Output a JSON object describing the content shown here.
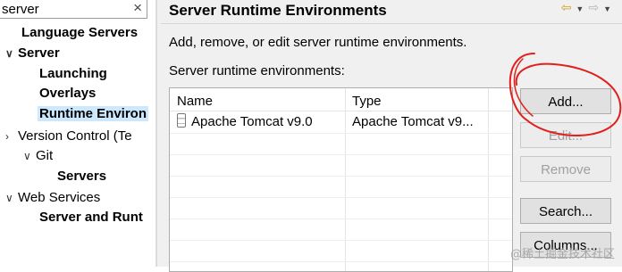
{
  "filter": {
    "value": "server",
    "clear_icon": "×"
  },
  "tree": [
    {
      "label": "Language Servers",
      "bold": true
    },
    {
      "label": "Server",
      "bold": true,
      "expanded": true
    },
    {
      "label": "Launching",
      "bold": true
    },
    {
      "label": "Overlays",
      "bold": true
    },
    {
      "label": "Runtime Environ",
      "bold": true,
      "selected": true
    },
    {
      "label": "Version Control (Te",
      "bold": false,
      "collapsed": true
    },
    {
      "label": "Git",
      "bold": false,
      "expanded": true
    },
    {
      "label": "Servers",
      "bold": true
    },
    {
      "label": "Web Services",
      "bold": false,
      "expanded": true
    },
    {
      "label": "Server and Runt",
      "bold": true
    }
  ],
  "page": {
    "title": "Server Runtime Environments",
    "description": "Add, remove, or edit server runtime environments.",
    "list_label": "Server runtime environments:",
    "nav_icons": [
      "back-arrow-icon",
      "forward-arrow-icon",
      "menu-chevron-icon"
    ]
  },
  "table": {
    "columns": [
      "Name",
      "Type"
    ],
    "rows": [
      {
        "name": "Apache Tomcat v9.0",
        "type": "Apache Tomcat v9..."
      }
    ]
  },
  "buttons": {
    "add": "Add...",
    "edit": "Edit...",
    "remove": "Remove",
    "search": "Search...",
    "columns": "Columns..."
  },
  "watermark": "@稀土掘金技术社区",
  "colors": {
    "selection": "#cce8ff",
    "annotation": "#e0201b",
    "panel": "#f0f0f0"
  }
}
